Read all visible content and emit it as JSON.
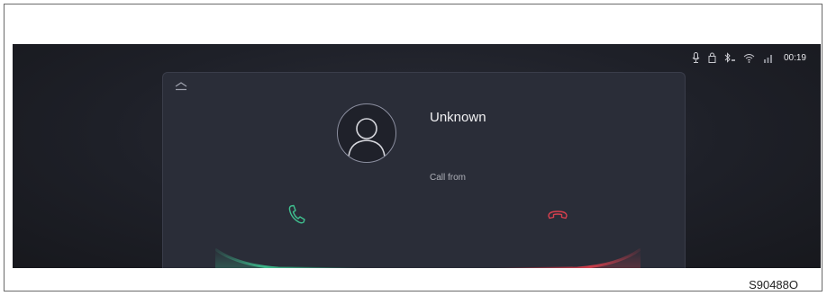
{
  "status_bar": {
    "icons": [
      "microphone-icon",
      "lock-icon",
      "bluetooth-icon",
      "wifi-icon",
      "signal-icon"
    ],
    "time": "00:19"
  },
  "call": {
    "caller_name": "Unknown",
    "subtitle": "Call from",
    "accept_color": "#3fbf8f",
    "decline_color": "#d8404e"
  },
  "figure": {
    "code": "S90488O"
  }
}
